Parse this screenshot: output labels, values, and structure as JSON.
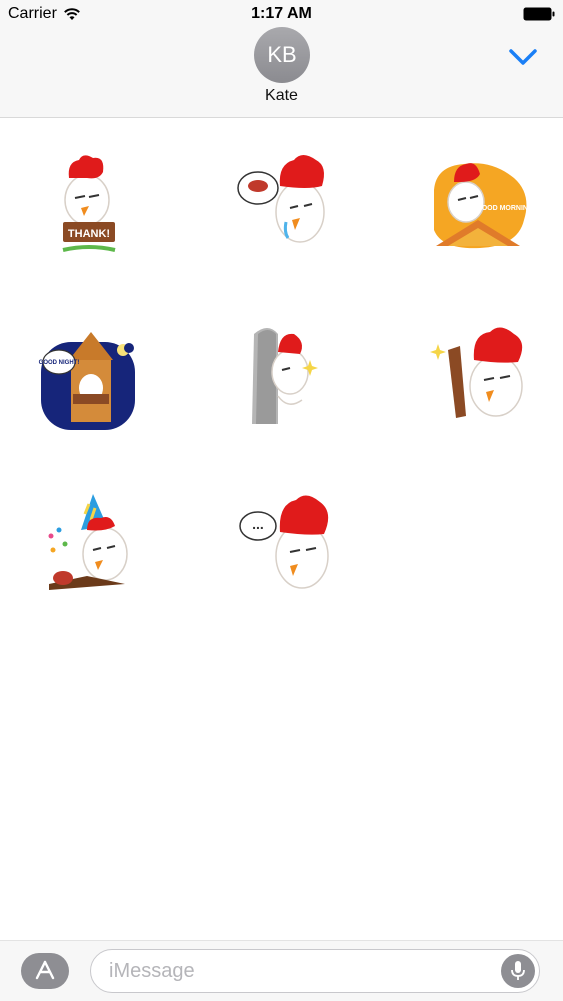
{
  "status_bar": {
    "carrier": "Carrier",
    "time": "1:17 AM"
  },
  "header": {
    "avatar_initials": "KB",
    "contact_name": "Kate"
  },
  "stickers": [
    {
      "name": "thank-you",
      "caption": "THANK!"
    },
    {
      "name": "thinking-steak",
      "caption": ""
    },
    {
      "name": "good-morning",
      "caption": "GOOD MORNING!"
    },
    {
      "name": "good-night",
      "caption": "GOOD NIGHT!"
    },
    {
      "name": "peek",
      "caption": ""
    },
    {
      "name": "torch",
      "caption": ""
    },
    {
      "name": "birthday",
      "caption": ""
    },
    {
      "name": "typing",
      "caption": "..."
    }
  ],
  "composer": {
    "placeholder": "iMessage"
  },
  "icons": {
    "wifi": "wifi-icon",
    "battery": "battery-icon",
    "collapse": "chevron-down-icon",
    "app_store": "app-store-icon",
    "mic": "microphone-icon"
  },
  "colors": {
    "accent": "#1a7ff6",
    "rooster_comb": "#e01b1b"
  }
}
